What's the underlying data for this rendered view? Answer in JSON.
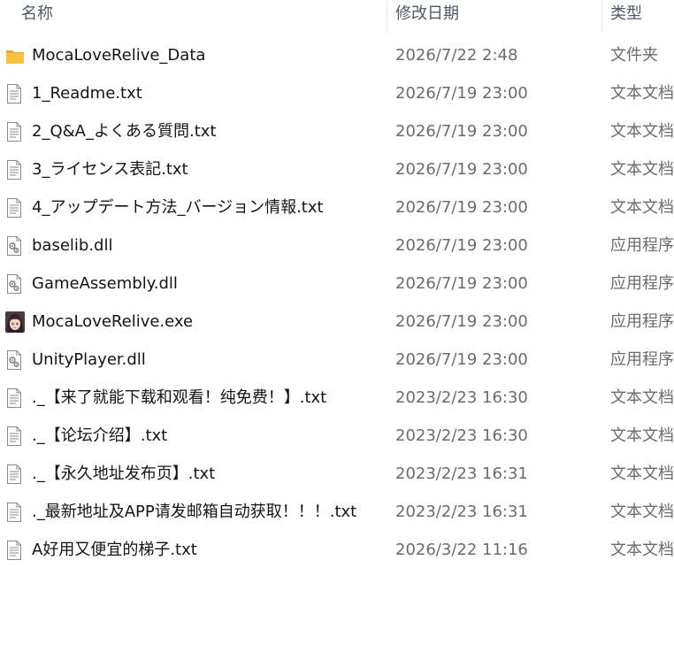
{
  "header": {
    "name_label": "名称",
    "date_label": "修改日期",
    "type_label": "类型",
    "sort_caret": "^"
  },
  "files": [
    {
      "name": "MocaLoveRelive_Data",
      "date": "2026/7/22 2:48",
      "type": "文件夹",
      "icon": "folder-icon"
    },
    {
      "name": "1_Readme.txt",
      "date": "2026/7/19 23:00",
      "type": "文本文档",
      "icon": "text-document-icon"
    },
    {
      "name": "2_Q&A_よくある質問.txt",
      "date": "2026/7/19 23:00",
      "type": "文本文档",
      "icon": "text-document-icon"
    },
    {
      "name": "3_ライセンス表記.txt",
      "date": "2026/7/19 23:00",
      "type": "文本文档",
      "icon": "text-document-icon"
    },
    {
      "name": "4_アップデート方法_バージョン情報.txt",
      "date": "2026/7/19 23:00",
      "type": "文本文档",
      "icon": "text-document-icon"
    },
    {
      "name": "baselib.dll",
      "date": "2026/7/19 23:00",
      "type": "应用程序",
      "icon": "dll-file-icon"
    },
    {
      "name": "GameAssembly.dll",
      "date": "2026/7/19 23:00",
      "type": "应用程序",
      "icon": "dll-file-icon"
    },
    {
      "name": "MocaLoveRelive.exe",
      "date": "2026/7/19 23:00",
      "type": "应用程序",
      "icon": "game-exe-icon"
    },
    {
      "name": "UnityPlayer.dll",
      "date": "2026/7/19 23:00",
      "type": "应用程序",
      "icon": "dll-file-icon"
    },
    {
      "name": "._【来了就能下载和观看！纯免费！】.txt",
      "date": "2023/2/23 16:30",
      "type": "文本文档",
      "icon": "text-document-icon"
    },
    {
      "name": "._【论坛介绍】.txt",
      "date": "2023/2/23 16:30",
      "type": "文本文档",
      "icon": "text-document-icon"
    },
    {
      "name": "._【永久地址发布页】.txt",
      "date": "2023/2/23 16:31",
      "type": "文本文档",
      "icon": "text-document-icon"
    },
    {
      "name": "._最新地址及APP请发邮箱自动获取！！！.txt",
      "date": "2023/2/23 16:31",
      "type": "文本文档",
      "icon": "text-document-icon"
    },
    {
      "name": "A好用又便宜的梯子.txt",
      "date": "2026/3/22 11:16",
      "type": "文本文档",
      "icon": "text-document-icon"
    }
  ],
  "colors": {
    "folder": "#f5c342",
    "folder_dark": "#e0a82e",
    "doc_stroke": "#8a8a8a",
    "header_text": "#4d5a6b",
    "secondary_text": "#6b6b6b"
  }
}
